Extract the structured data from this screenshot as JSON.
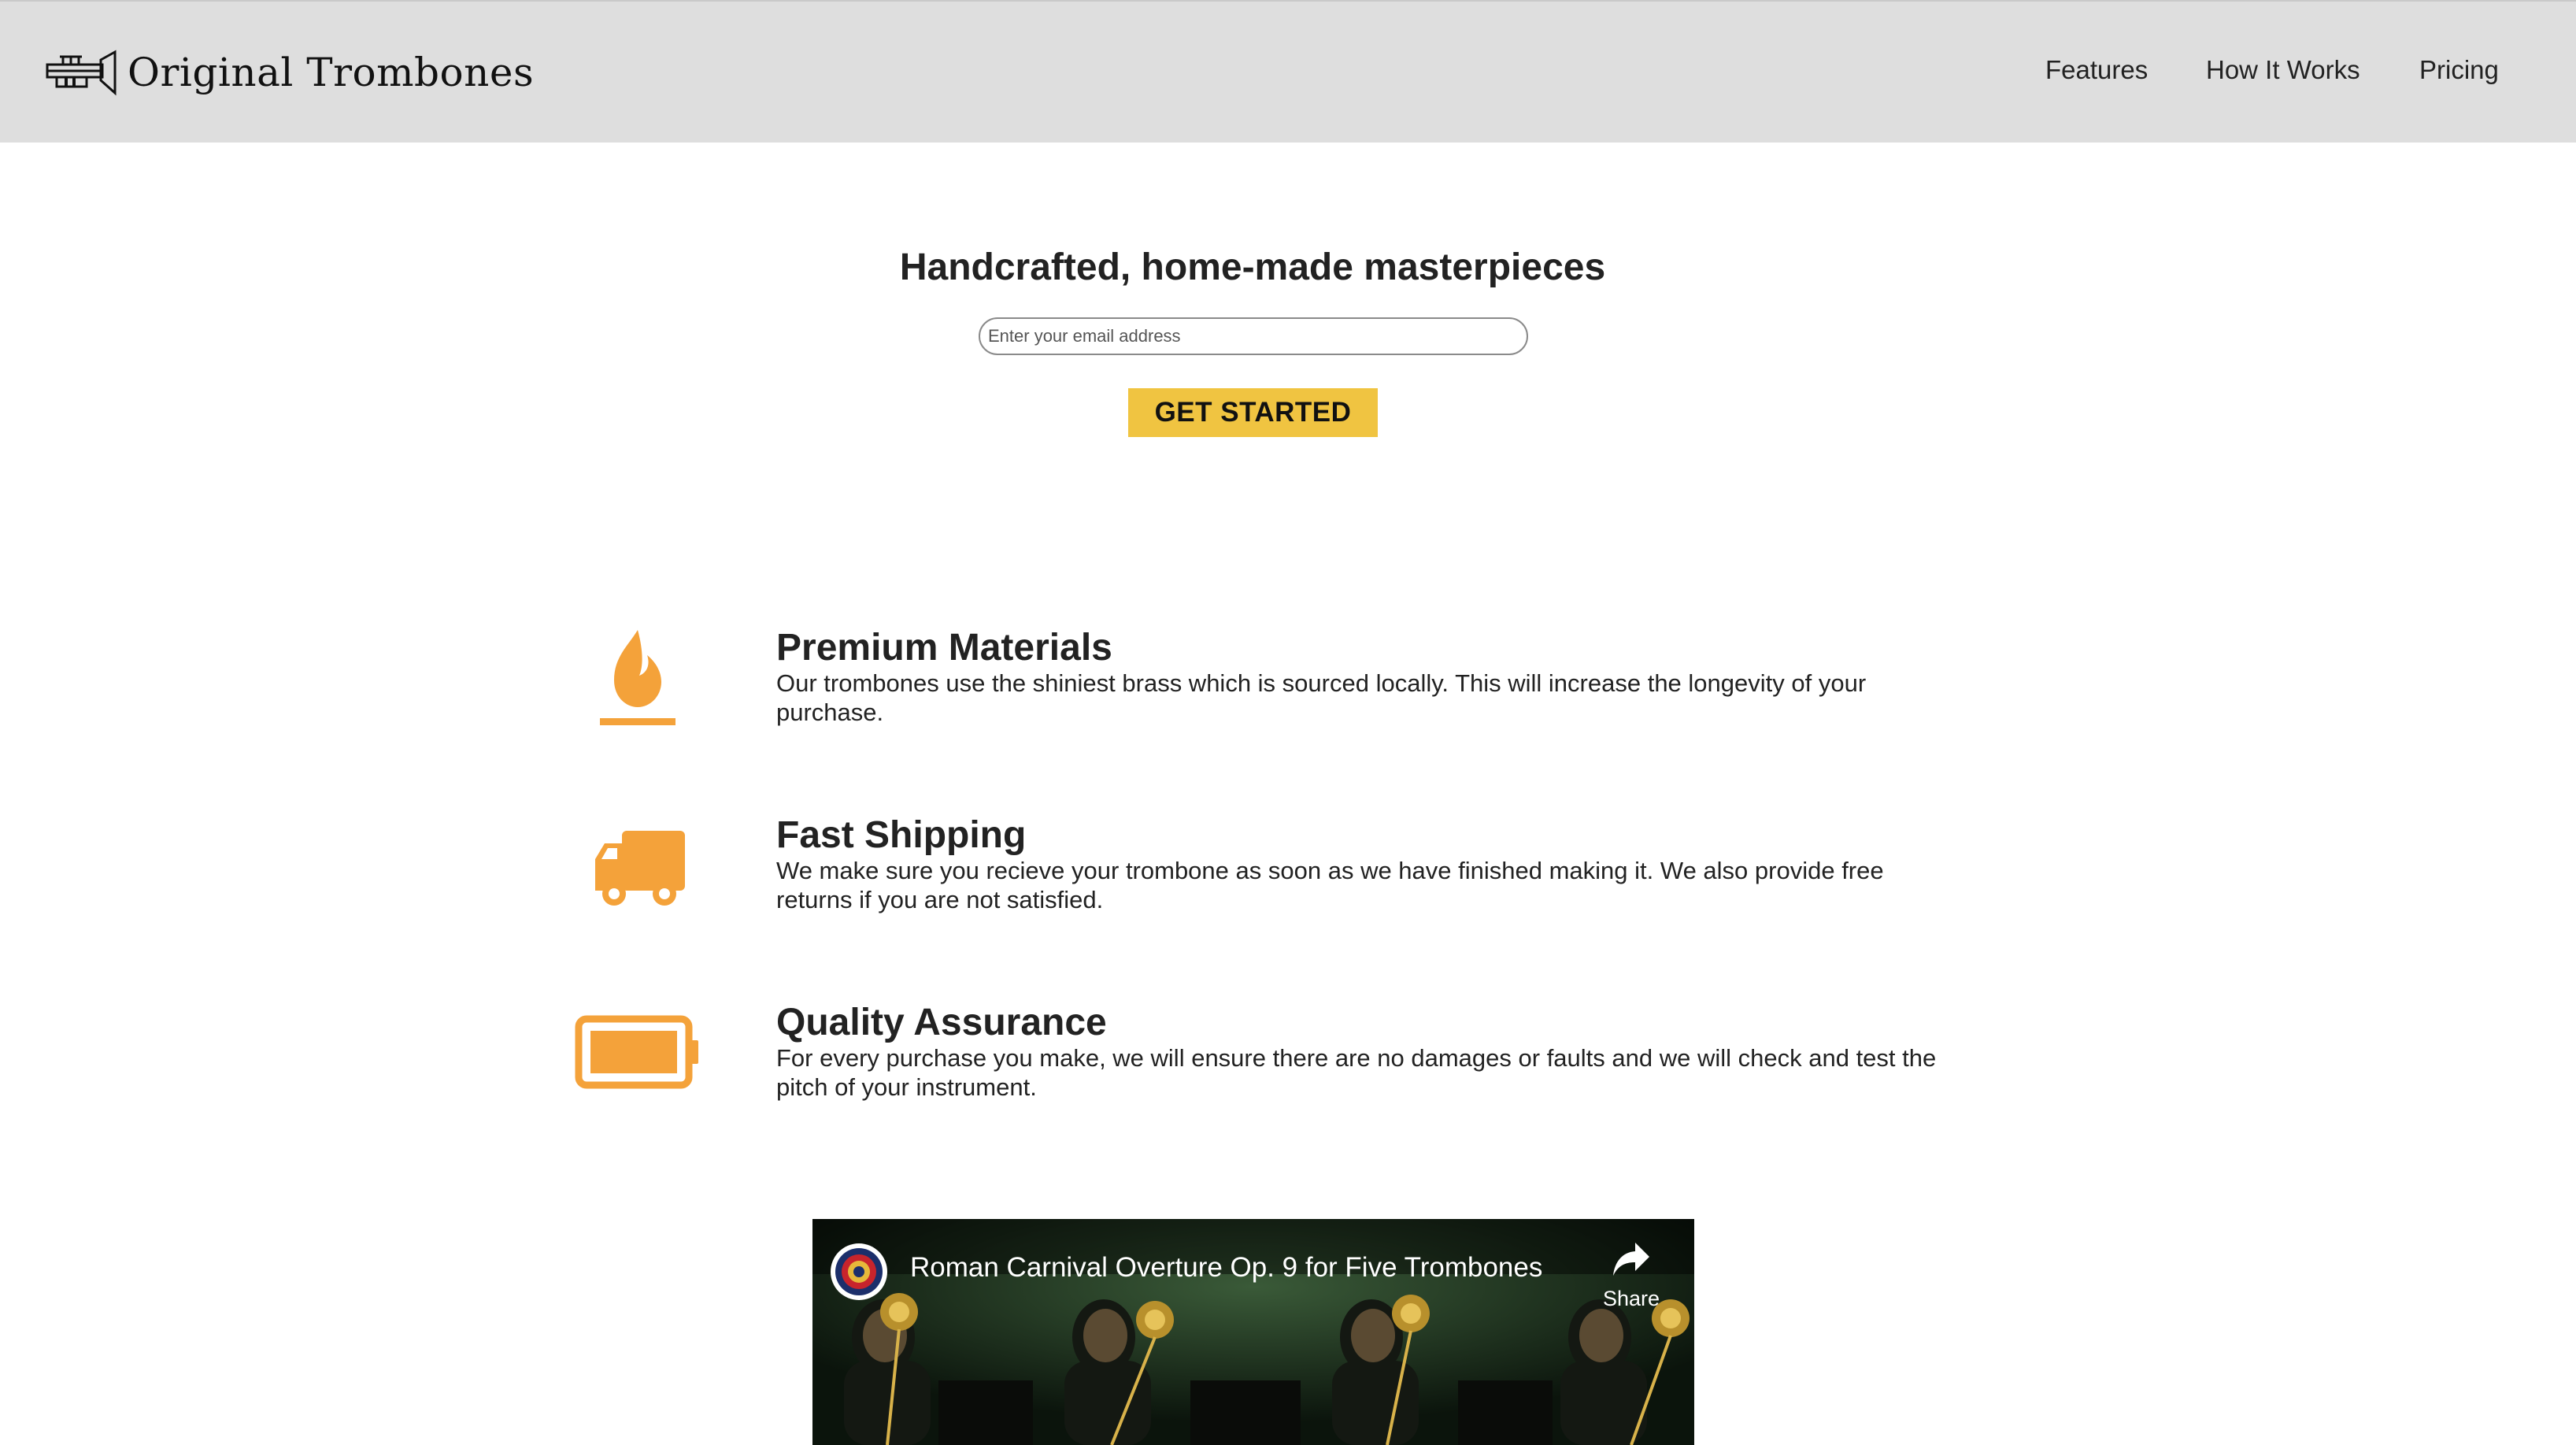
{
  "header": {
    "logo_text": "Original Trombones",
    "logo_icon": "trumpet-icon",
    "nav": [
      {
        "label": "Features"
      },
      {
        "label": "How It Works"
      },
      {
        "label": "Pricing"
      }
    ]
  },
  "hero": {
    "title": "Handcrafted, home-made masterpieces",
    "email_placeholder": "Enter your email address",
    "cta_label": "GET STARTED"
  },
  "features": [
    {
      "icon": "fire-icon",
      "title": "Premium Materials",
      "description": "Our trombones use the shiniest brass which is sourced locally. This will increase the longevity of your purchase."
    },
    {
      "icon": "truck-icon",
      "title": "Fast Shipping",
      "description": "We make sure you recieve your trombone as soon as we have finished making it. We also provide free returns if you are not satisfied."
    },
    {
      "icon": "battery-full-icon",
      "title": "Quality Assurance",
      "description": "For every purchase you make, we will ensure there are no damages or faults and we will check and test the pitch of your instrument."
    }
  ],
  "video": {
    "title": "Roman Carnival Overture Op. 9 for Five Trombones",
    "share_label": "Share",
    "channel_icon": "channel-logo-icon",
    "share_icon": "share-arrow-icon"
  },
  "colors": {
    "accent": "#f0c441",
    "icon_orange": "#f4a23a",
    "header_bg": "#dedede"
  }
}
